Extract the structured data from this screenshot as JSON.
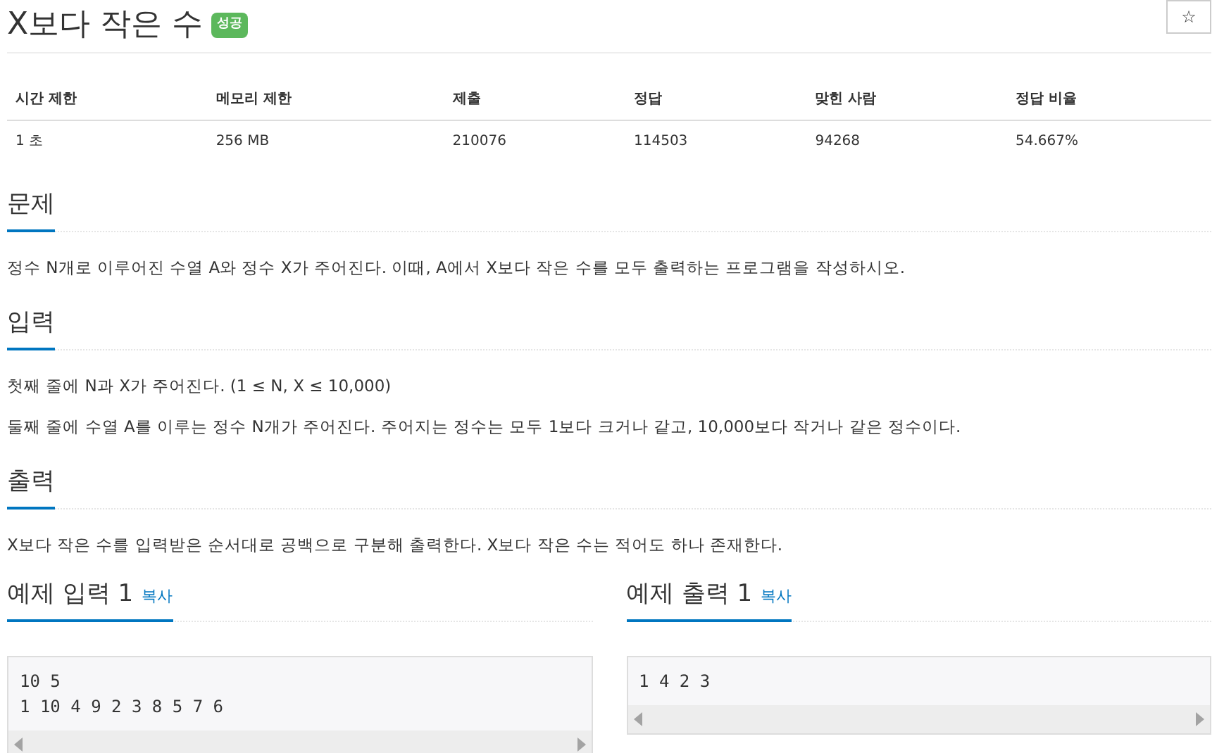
{
  "title": "X보다 작은 수",
  "badge": "성공",
  "star": "☆",
  "table": {
    "columns": [
      "시간 제한",
      "메모리 제한",
      "제출",
      "정답",
      "맞힌 사람",
      "정답 비율"
    ],
    "rows": [
      [
        "1 초",
        "256 MB",
        "210076",
        "114503",
        "94268",
        "54.667%"
      ]
    ]
  },
  "sections": [
    {
      "heading": "문제",
      "paragraphs": [
        "정수 N개로 이루어진 수열 A와 정수 X가 주어진다. 이때, A에서 X보다 작은 수를 모두 출력하는 프로그램을 작성하시오."
      ]
    },
    {
      "heading": "입력",
      "paragraphs": [
        "첫째 줄에 N과 X가 주어진다. (1 ≤ N, X ≤ 10,000)",
        "둘째 줄에 수열 A를 이루는 정수 N개가 주어진다. 주어지는 정수는 모두 1보다 크거나 같고, 10,000보다 작거나 같은 정수이다."
      ]
    },
    {
      "heading": "출력",
      "paragraphs": [
        "X보다 작은 수를 입력받은 순서대로 공백으로 구분해 출력한다. X보다 작은 수는 적어도 하나 존재한다."
      ]
    }
  ],
  "samples": [
    {
      "heading": "예제 입력 1",
      "copy": "복사",
      "lines": [
        "10 5",
        "1 10 4 9 2 3 8 5 7 6"
      ]
    },
    {
      "heading": "예제 출력 1",
      "copy": "복사",
      "lines": [
        "1 4 2 3"
      ]
    }
  ]
}
